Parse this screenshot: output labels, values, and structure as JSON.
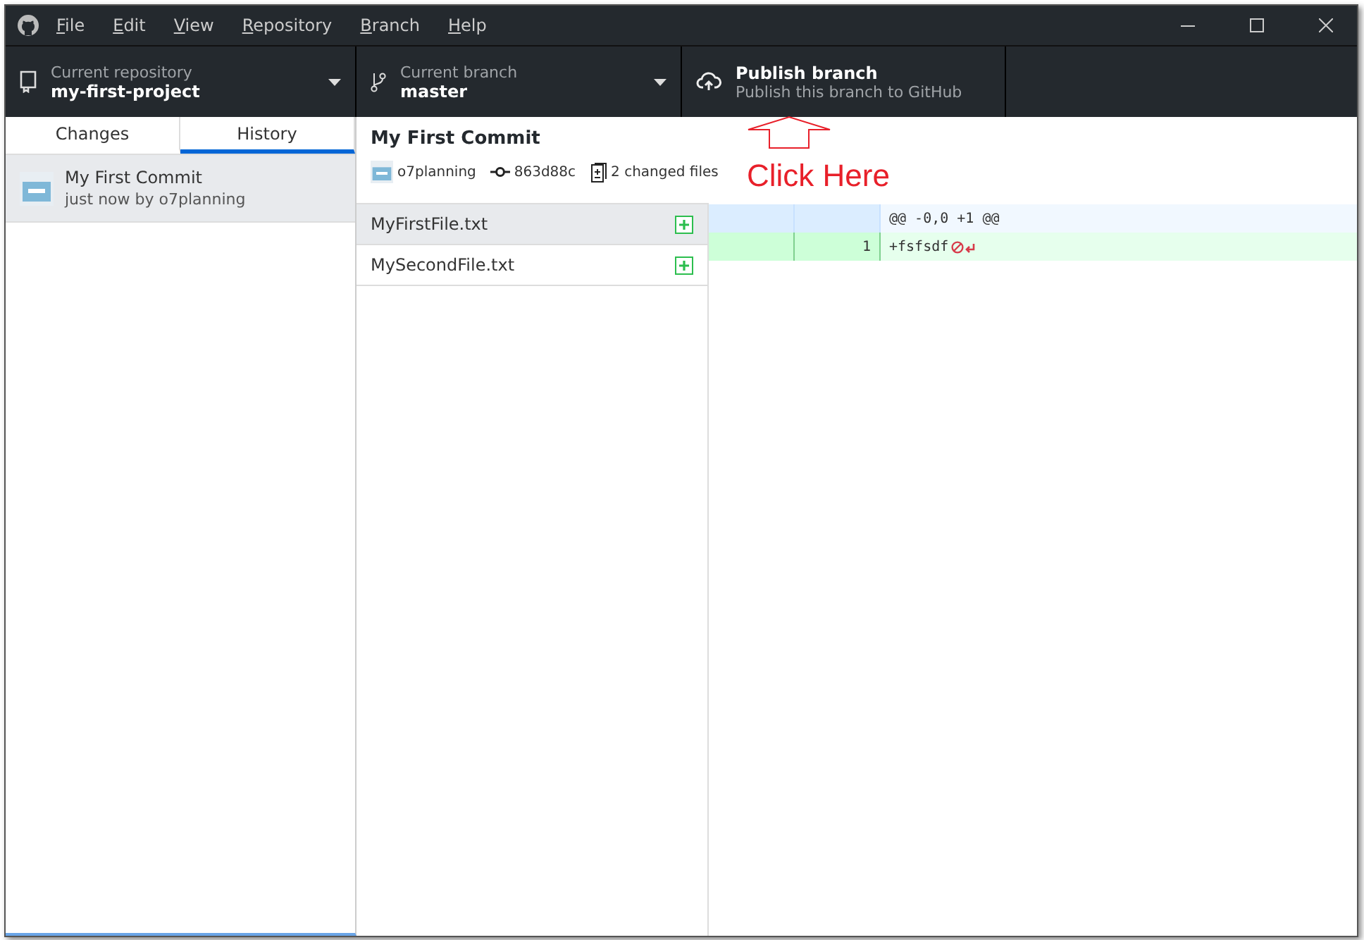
{
  "menu": [
    "File",
    "Edit",
    "View",
    "Repository",
    "Branch",
    "Help"
  ],
  "toolbar": [
    {
      "kind": "repository",
      "label": "Current repository",
      "value": "my-first-project"
    },
    {
      "kind": "branch",
      "label": "Current branch",
      "value": "master"
    },
    {
      "kind": "publish",
      "label": "Publish branch",
      "value": "Publish this branch to GitHub"
    }
  ],
  "tabs": [
    {
      "label": "Changes",
      "selected": false
    },
    {
      "label": "History",
      "selected": true
    }
  ],
  "commits": [
    {
      "title": "My First Commit",
      "meta": "just now by o7planning",
      "selected": true
    }
  ],
  "commit_detail": {
    "title": "My First Commit",
    "author": "o7planning",
    "sha": "863d88c",
    "files_count": "2 changed files"
  },
  "files": [
    {
      "name": "MyFirstFile.txt",
      "selected": true
    },
    {
      "name": "MySecondFile.txt",
      "selected": false
    }
  ],
  "diff": [
    {
      "kind": "hunk",
      "text": "@@ -0,0 +1 @@"
    },
    {
      "kind": "add",
      "new": "1",
      "text": "+fsfsdf"
    }
  ],
  "annotation": "Click Here"
}
